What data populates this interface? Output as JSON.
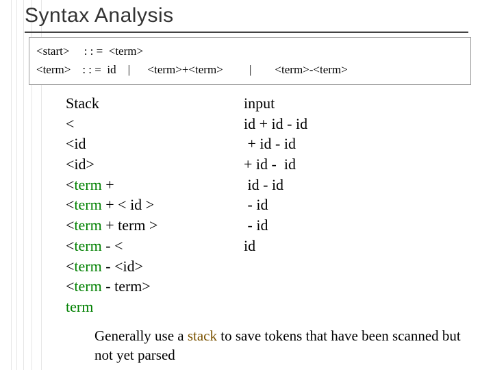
{
  "title": "Syntax Analysis",
  "grammar": {
    "line1_lhs": "<start>",
    "line1_op": ": : =",
    "line1_rhs": "<term>",
    "line2_lhs": "<term>",
    "line2_op": ": : =",
    "line2_rhs_a": "id",
    "line2_sep1": "|",
    "line2_rhs_b": "<term>+<term>",
    "line2_sep2": "|",
    "line2_rhs_c": "<term>-<term>"
  },
  "trace": {
    "header_stack": "Stack",
    "header_input": "input",
    "rows": [
      {
        "stack_pre": "<",
        "stack_term": "",
        "stack_post": "",
        "input": "id + id - id"
      },
      {
        "stack_pre": "<id",
        "stack_term": "",
        "stack_post": "",
        "input": " + id - id"
      },
      {
        "stack_pre": "<id>",
        "stack_term": "",
        "stack_post": "",
        "input": "+ id -  id"
      },
      {
        "stack_pre": "<",
        "stack_term": "term",
        "stack_post": " +",
        "input": " id - id"
      },
      {
        "stack_pre": "<",
        "stack_term": "term",
        "stack_post": " + < id >",
        "input": " - id"
      },
      {
        "stack_pre": "<",
        "stack_term": "term",
        "stack_post": " + term >",
        "input": " - id"
      },
      {
        "stack_pre": "<",
        "stack_term": "term",
        "stack_post": " - <",
        "input": "id"
      },
      {
        "stack_pre": "<",
        "stack_term": "term",
        "stack_post": " - <id>",
        "input": ""
      },
      {
        "stack_pre": "<",
        "stack_term": "term",
        "stack_post": " - term>",
        "input": ""
      },
      {
        "stack_pre": "",
        "stack_term": "term",
        "stack_post": "",
        "input": ""
      }
    ]
  },
  "note": {
    "pre": "Generally use a ",
    "kw": "stack",
    "post": " to save tokens that have been scanned but not yet parsed"
  }
}
